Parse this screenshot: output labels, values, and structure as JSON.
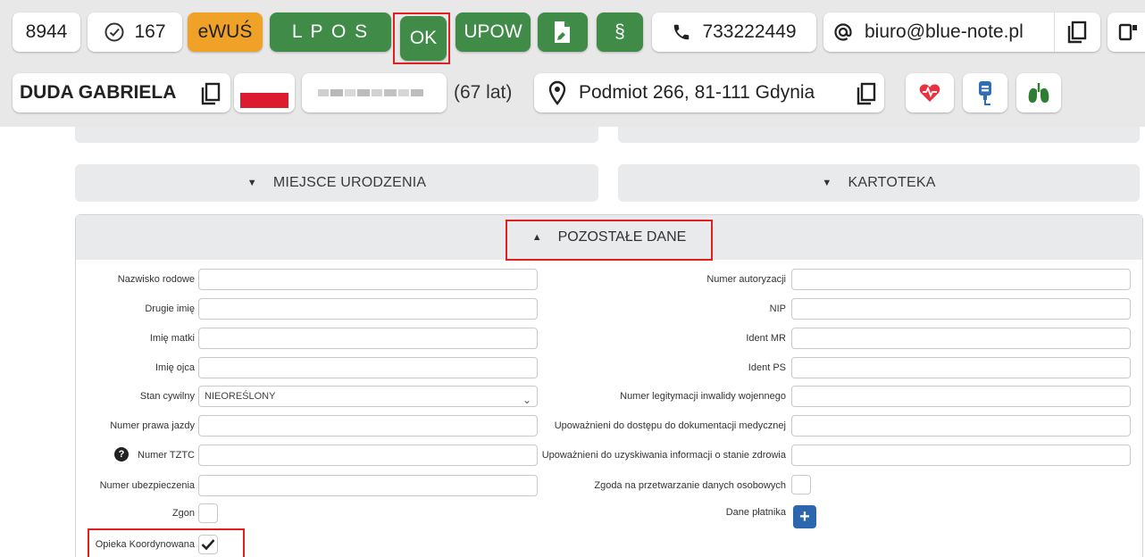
{
  "header": {
    "row1": {
      "id_value": "8944",
      "check_count": "167",
      "ewus_label": "eWUŚ",
      "lpos_label": "L P O S",
      "ok_label": "OK",
      "upow_label": "UPOW",
      "paragraph_label": "§",
      "phone": "733222449",
      "email": "biuro@blue-note.pl"
    },
    "row2": {
      "patient_name": "DUDA GABRIELA",
      "age": "(67 lat)",
      "address": "Podmiot 266, 81-111 Gdynia"
    }
  },
  "sections": {
    "miejsce_urodzenia": "MIEJSCE URODZENIA",
    "kartoteka": "KARTOTEKA",
    "pozostale_dane": "POZOSTAŁE DANE"
  },
  "form": {
    "left": {
      "nazwisko_rodowe": {
        "label": "Nazwisko rodowe",
        "value": ""
      },
      "drugie_imie": {
        "label": "Drugie imię",
        "value": ""
      },
      "imie_matki": {
        "label": "Imię matki",
        "value": ""
      },
      "imie_ojca": {
        "label": "Imię ojca",
        "value": ""
      },
      "stan_cywilny": {
        "label": "Stan cywilny",
        "value": "NIEOREŚLONY"
      },
      "numer_prawa_jazdy": {
        "label": "Numer prawa jazdy",
        "value": ""
      },
      "numer_tztc": {
        "label": "Numer TZTC",
        "value": ""
      },
      "numer_ubezpieczenia": {
        "label": "Numer ubezpieczenia",
        "value": ""
      },
      "zgon": {
        "label": "Zgon",
        "checked": false
      },
      "opieka_koordynowana": {
        "label": "Opieka Koordynowana",
        "checked": true
      }
    },
    "right": {
      "numer_autoryzacji": {
        "label": "Numer autoryzacji",
        "value": ""
      },
      "nip": {
        "label": "NIP",
        "value": ""
      },
      "ident_mr": {
        "label": "Ident MR",
        "value": ""
      },
      "ident_ps": {
        "label": "Ident PS",
        "value": ""
      },
      "numer_legitymacji": {
        "label": "Numer legitymacji inwalidy wojennego",
        "value": ""
      },
      "upowaznieni_dostep": {
        "label": "Upoważnieni do dostępu do dokumentacji medycznej",
        "value": ""
      },
      "upowaznieni_info": {
        "label": "Upoważnieni do uzyskiwania informacji o stanie zdrowia",
        "value": ""
      },
      "zgoda": {
        "label": "Zgoda na przetwarzanie danych osobowych",
        "checked": false
      },
      "dane_platnika": {
        "label": "Dane płatnika"
      }
    }
  },
  "colors": {
    "green": "#3f8b47",
    "orange": "#f0a228",
    "highlight_red": "#e02020",
    "plus_blue": "#2c66ad",
    "header_bg": "#e8e8e8",
    "section_bg": "#e9eaeb"
  },
  "icons": [
    "check-circle-icon",
    "document-sign-icon",
    "phone-icon",
    "at-sign-icon",
    "copy-icon",
    "device-icon",
    "poland-flag-icon",
    "location-pin-icon",
    "heart-pulse-icon",
    "iv-drip-icon",
    "lungs-icon",
    "help-icon",
    "checkmark-icon",
    "plus-icon",
    "caret-down-icon",
    "caret-up-icon"
  ]
}
